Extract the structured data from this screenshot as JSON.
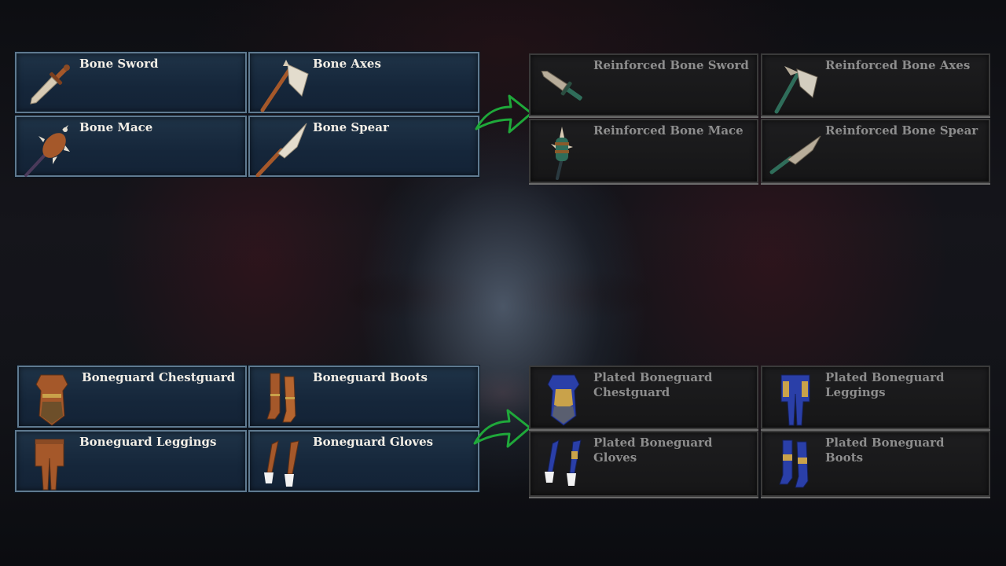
{
  "base_weapons": [
    {
      "name": "Bone Sword",
      "icon": "sword-icon"
    },
    {
      "name": "Bone Axes",
      "icon": "axe-icon"
    },
    {
      "name": "Bone Mace",
      "icon": "mace-icon"
    },
    {
      "name": "Bone Spear",
      "icon": "spear-icon"
    }
  ],
  "upgraded_weapons": [
    {
      "name": "Reinforced Bone Sword",
      "icon": "sword-icon"
    },
    {
      "name": "Reinforced Bone Axes",
      "icon": "axe-icon"
    },
    {
      "name": "Reinforced Bone Mace",
      "icon": "mace-icon"
    },
    {
      "name": "Reinforced Bone Spear",
      "icon": "spear-icon"
    }
  ],
  "base_armor": [
    {
      "name": "Boneguard Chestguard",
      "icon": "chestguard-icon"
    },
    {
      "name": "Boneguard Boots",
      "icon": "boots-icon"
    },
    {
      "name": "Boneguard Leggings",
      "icon": "leggings-icon"
    },
    {
      "name": "Boneguard Gloves",
      "icon": "gloves-icon"
    }
  ],
  "upgraded_armor": [
    {
      "name": "Plated Boneguard Chestguard",
      "icon": "chestguard-icon"
    },
    {
      "name": "Plated Boneguard Leggings",
      "icon": "leggings-icon"
    },
    {
      "name": "Plated Boneguard Gloves",
      "icon": "gloves-icon"
    },
    {
      "name": "Plated Boneguard Boots",
      "icon": "boots-icon"
    }
  ],
  "colors": {
    "arrow": "#1fa83a",
    "base_panel": "#1a2c40",
    "upgraded_panel": "#1a1a1b",
    "bone": "#d8cbb4",
    "leather": "#a5582a",
    "teal_metal": "#2f6d5a",
    "plate_blue": "#2a3fa8",
    "gold": "#c9a24a"
  }
}
